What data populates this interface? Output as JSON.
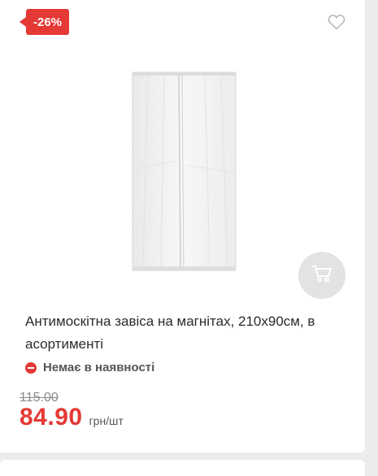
{
  "product": {
    "discount_badge": "-26%",
    "title": "Антимоскітна завіса на магнітах, 210х90см, в асортименті",
    "availability": "Немає в наявності",
    "old_price": "115.00",
    "price": "84.90",
    "unit": "грн/шт"
  },
  "icons": {
    "favorite": "heart-icon",
    "cart": "cart-icon",
    "availability": "minus-circle-icon"
  },
  "colors": {
    "accent": "#e53935",
    "cart_button_bg": "#e3e3e3",
    "text": "#2b2b2b"
  }
}
